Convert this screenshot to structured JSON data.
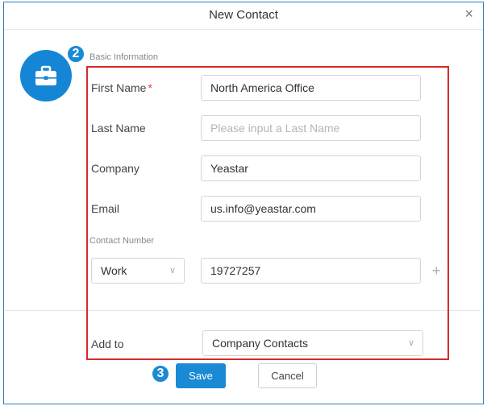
{
  "dialog": {
    "title": "New Contact",
    "close_glyph": "×",
    "icon": "briefcase-icon"
  },
  "badges": {
    "step2": "2",
    "step3": "3"
  },
  "basic_info": {
    "section_label": "Basic Information",
    "first_name": {
      "label": "First Name",
      "required_mark": "*",
      "value": "North America Office"
    },
    "last_name": {
      "label": "Last Name",
      "placeholder": "Please input a Last Name"
    },
    "company": {
      "label": "Company",
      "value": "Yeastar"
    },
    "email": {
      "label": "Email",
      "value": "us.info@yeastar.com"
    }
  },
  "contact_number": {
    "section_label": "Contact Number",
    "type": "Work",
    "number": "19727257",
    "add_glyph": "+"
  },
  "add_to": {
    "label": "Add to",
    "value": "Company Contacts"
  },
  "footer": {
    "save_label": "Save",
    "cancel_label": "Cancel"
  },
  "colors": {
    "accent": "#1a8ad4",
    "highlight": "#d62b2b"
  }
}
